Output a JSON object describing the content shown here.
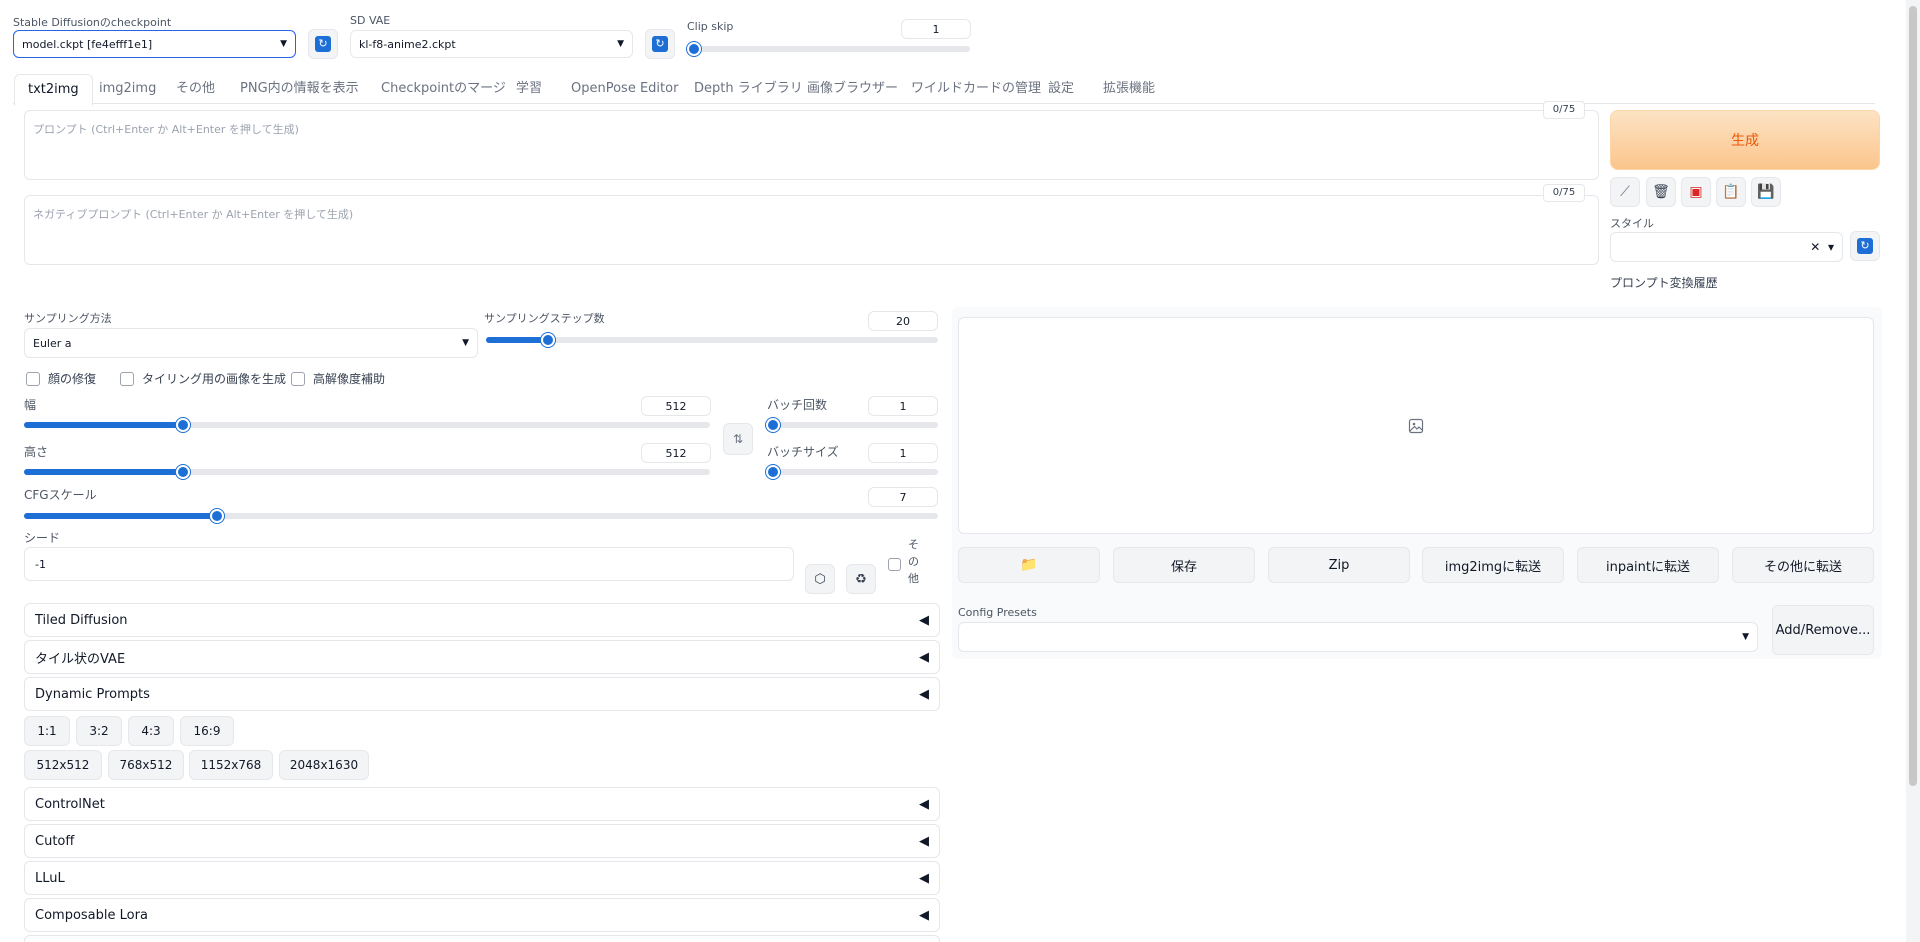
{
  "top": {
    "checkpoint_label": "Stable Diffusionのcheckpoint",
    "checkpoint_value": "model.ckpt [fe4efff1e1]",
    "vae_label": "SD VAE",
    "vae_value": "kl-f8-anime2.ckpt",
    "clip_skip_label": "Clip skip",
    "clip_skip_value": "1"
  },
  "tabs": [
    "txt2img",
    "img2img",
    "その他",
    "PNG内の情報を表示",
    "Checkpointのマージ",
    "学習",
    "OpenPose Editor",
    "Depth ライブラリ",
    "画像ブラウザー",
    "ワイルドカードの管理",
    "設定",
    "拡張機能"
  ],
  "prompt": {
    "placeholder": "プロンプト (Ctrl+Enter か Alt+Enter を押して生成)",
    "counter": "0/75"
  },
  "negative_prompt": {
    "placeholder": "ネガティブプロンプト (Ctrl+Enter か Alt+Enter を押して生成)",
    "counter": "0/75"
  },
  "generate_label": "生成",
  "style_label": "スタイル",
  "prompt_history_label": "プロンプト変換履歴",
  "sampling": {
    "method_label": "サンプリング方法",
    "method_value": "Euler a",
    "steps_label": "サンプリングステップ数",
    "steps_value": "20"
  },
  "checks": [
    "顔の修復",
    "タイリング用の画像を生成",
    "高解像度補助"
  ],
  "width": {
    "label": "幅",
    "value": "512"
  },
  "height": {
    "label": "高さ",
    "value": "512"
  },
  "batch_count": {
    "label": "バッチ回数",
    "value": "1"
  },
  "batch_size": {
    "label": "バッチサイズ",
    "value": "1"
  },
  "cfg": {
    "label": "CFGスケール",
    "value": "7"
  },
  "seed": {
    "label": "シード",
    "value": "-1",
    "extra_label": "その他"
  },
  "accordions_top": [
    "Tiled Diffusion",
    "タイル状のVAE",
    "Dynamic Prompts"
  ],
  "ratio_buttons": [
    "1:1",
    "3:2",
    "4:3",
    "16:9"
  ],
  "size_buttons": [
    "512x512",
    "768x512",
    "1152x768",
    "2048x1630"
  ],
  "accordions_bottom": [
    "ControlNet",
    "Cutoff",
    "LLuL",
    "Composable Lora"
  ],
  "output_buttons": [
    "保存",
    "Zip",
    "img2imgに転送",
    "inpaintに転送",
    "その他に転送"
  ],
  "config_presets": {
    "label": "Config Presets",
    "button": "Add/Remove..."
  },
  "colors": {
    "accent": "#1d6fd6",
    "generate_bg": "#fdd5a8",
    "generate_text": "#ea580c"
  }
}
